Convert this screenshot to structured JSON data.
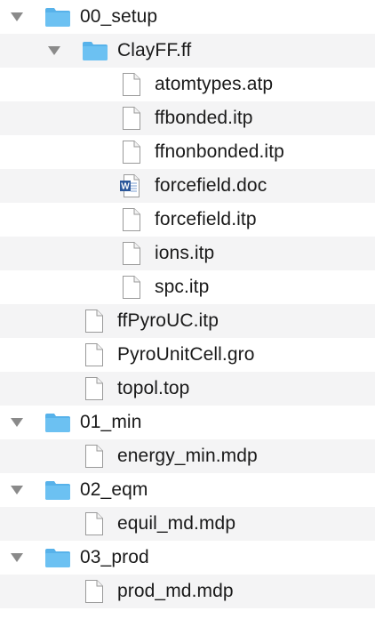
{
  "tree": [
    {
      "name": "00_setup",
      "kind": "folder",
      "expanded": true,
      "depth": 0
    },
    {
      "name": "ClayFF.ff",
      "kind": "folder",
      "expanded": true,
      "depth": 1
    },
    {
      "name": "atomtypes.atp",
      "kind": "file",
      "depth": 2
    },
    {
      "name": "ffbonded.itp",
      "kind": "file",
      "depth": 2
    },
    {
      "name": "ffnonbonded.itp",
      "kind": "file",
      "depth": 2
    },
    {
      "name": "forcefield.doc",
      "kind": "word-doc",
      "depth": 2
    },
    {
      "name": "forcefield.itp",
      "kind": "file",
      "depth": 2
    },
    {
      "name": "ions.itp",
      "kind": "file",
      "depth": 2
    },
    {
      "name": "spc.itp",
      "kind": "file",
      "depth": 2
    },
    {
      "name": "ffPyroUC.itp",
      "kind": "file",
      "depth": 1
    },
    {
      "name": "PyroUnitCell.gro",
      "kind": "file",
      "depth": 1
    },
    {
      "name": "topol.top",
      "kind": "file",
      "depth": 1
    },
    {
      "name": "01_min",
      "kind": "folder",
      "expanded": true,
      "depth": 0
    },
    {
      "name": "energy_min.mdp",
      "kind": "file",
      "depth": 1
    },
    {
      "name": "02_eqm",
      "kind": "folder",
      "expanded": true,
      "depth": 0
    },
    {
      "name": "equil_md.mdp",
      "kind": "file",
      "depth": 1
    },
    {
      "name": "03_prod",
      "kind": "folder",
      "expanded": true,
      "depth": 0
    },
    {
      "name": "prod_md.mdp",
      "kind": "file",
      "depth": 1
    }
  ],
  "colors": {
    "row_alt": "#f4f4f5",
    "row_plain": "#ffffff",
    "folder_body": "#6cc1f2",
    "folder_tab": "#57b2ea",
    "disclosure": "#8a8a8a",
    "text": "#1a1a1a",
    "word_blue": "#2b579a"
  },
  "icons": {
    "folder": "folder-icon",
    "file": "file-icon",
    "word-doc": "word-document-icon",
    "disclosure": "disclosure-triangle-down-icon"
  }
}
